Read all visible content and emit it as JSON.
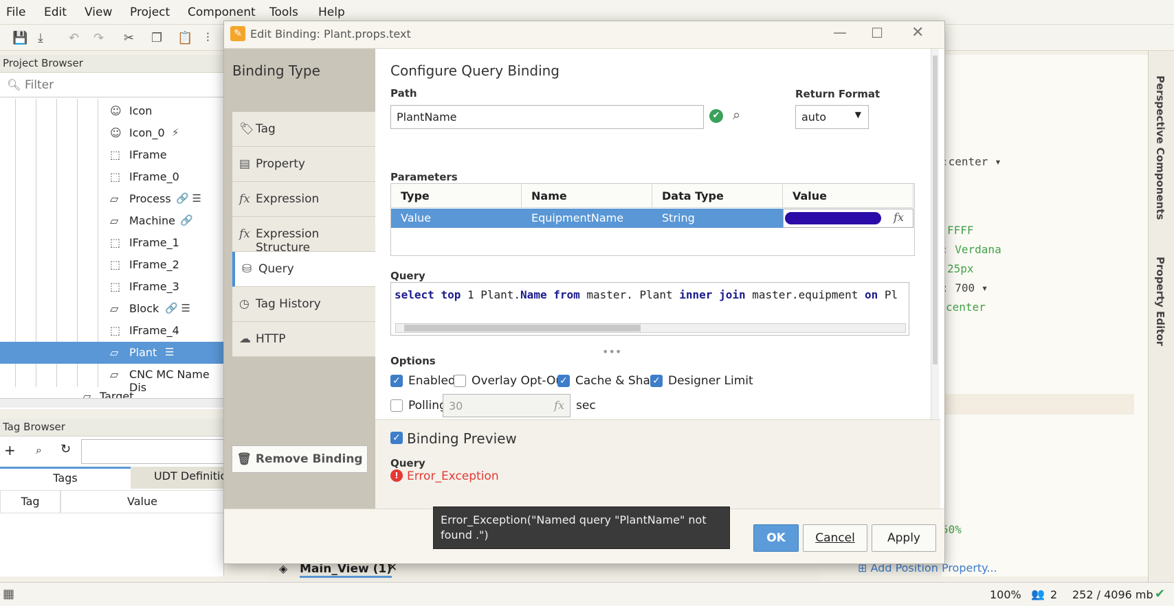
{
  "menubar": {
    "items": [
      "File",
      "Edit",
      "View",
      "Project",
      "Component",
      "Tools",
      "Help"
    ]
  },
  "project_browser": {
    "title": "Project Browser",
    "filter_placeholder": "Filter",
    "items": [
      {
        "label": "Icon",
        "icon": "smiley-icon"
      },
      {
        "label": "Icon_0",
        "icon": "smiley-icon",
        "extra": "⚡"
      },
      {
        "label": "IFrame",
        "icon": "iframe-icon"
      },
      {
        "label": "IFrame_0",
        "icon": "iframe-icon"
      },
      {
        "label": "Process",
        "icon": "view-icon",
        "extra": "🔗 ☰"
      },
      {
        "label": "Machine",
        "icon": "view-icon",
        "extra": "🔗"
      },
      {
        "label": "IFrame_1",
        "icon": "iframe-icon"
      },
      {
        "label": "IFrame_2",
        "icon": "iframe-icon"
      },
      {
        "label": "IFrame_3",
        "icon": "iframe-icon"
      },
      {
        "label": "Block",
        "icon": "view-icon",
        "extra": "🔗 ☰"
      },
      {
        "label": "IFrame_4",
        "icon": "iframe-icon"
      },
      {
        "label": "Plant",
        "icon": "view-icon",
        "extra": "☰"
      },
      {
        "label": "CNC MC Name Dis",
        "icon": "view-icon"
      },
      {
        "label": "Target",
        "icon": "view-icon"
      }
    ]
  },
  "tag_browser": {
    "title": "Tag Browser",
    "tabs": [
      "Tags",
      "UDT Definitio"
    ],
    "columns": [
      "Tag",
      "Value"
    ]
  },
  "dialog": {
    "title": "Edit Binding: Plant.props.text",
    "binding_type_title": "Binding Type",
    "binding_types": [
      {
        "label": "Tag",
        "icon": "tag-icon"
      },
      {
        "label": "Property",
        "icon": "property-icon"
      },
      {
        "label": "Expression",
        "icon": "fx-icon"
      },
      {
        "label": "Expression Structure",
        "icon": "fx-icon"
      },
      {
        "label": "Query",
        "icon": "database-icon"
      },
      {
        "label": "Tag History",
        "icon": "history-icon"
      },
      {
        "label": "HTTP",
        "icon": "cloud-icon"
      }
    ],
    "active_binding": "Query",
    "remove_binding_label": "Remove Binding",
    "config_title": "Configure Query Binding",
    "path_label": "Path",
    "path_value": "PlantName",
    "return_format_label": "Return Format",
    "return_format_value": "auto",
    "parameters_label": "Parameters",
    "param_columns": [
      "Type",
      "Name",
      "Data Type",
      "Value"
    ],
    "param_rows": [
      {
        "type": "Value",
        "name": "EquipmentName",
        "data_type": "String",
        "value": ""
      }
    ],
    "query_label": "Query",
    "query_text": {
      "k1": "select",
      "k2": "top",
      "t1": "1 Plant.",
      "k3": "Name",
      "k4": "from",
      "t2": "master. Plant",
      "k5": "inner join",
      "t3": "master.equipment",
      "k6": "on",
      "t4": "Pl"
    },
    "options_label": "Options",
    "options": {
      "enabled": {
        "label": "Enabled",
        "checked": true
      },
      "overlay": {
        "label": "Overlay Opt-Out",
        "checked": false
      },
      "cache": {
        "label": "Cache & Share",
        "checked": true
      },
      "designer": {
        "label": "Designer Limit",
        "checked": true
      },
      "polling": {
        "label": "Polling",
        "checked": false,
        "value": "30",
        "unit": "sec"
      }
    },
    "preview": {
      "title": "Binding Preview",
      "query_label": "Query",
      "value": "Error_Exception"
    },
    "buttons": {
      "ok": "OK",
      "cancel": "Cancel",
      "apply": "Apply"
    },
    "tooltip": "Error_Exception(\"Named query \"PlantName\" not found .\")"
  },
  "right_panel": {
    "values": [
      ":center",
      "FFFF",
      ": Verdana",
      "25px",
      ": 700",
      "center"
    ],
    "add_position": "Add Position Property...",
    "pct": "50%",
    "rail_labels": [
      "Perspective Components",
      "Property Editor"
    ]
  },
  "workspace": {
    "tab": "Main_View (1)"
  },
  "status": {
    "zoom": "100%",
    "users": "2",
    "memory": "252 / 4096 mb"
  },
  "colors": {
    "accent": "#5a97d6",
    "error": "#e53935",
    "keyword": "#1a1a8c",
    "green": "#43a047"
  }
}
